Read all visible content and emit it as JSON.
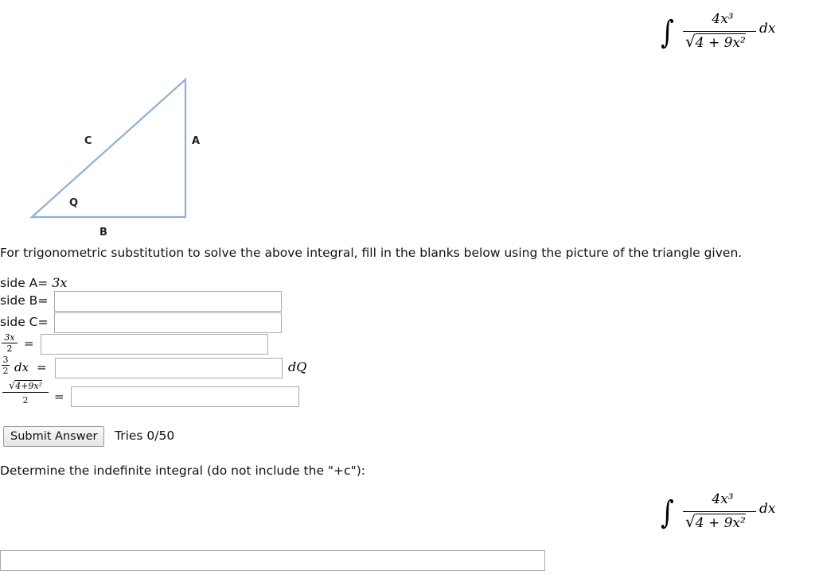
{
  "integral": {
    "sign": "∫",
    "numerator": "4x³",
    "denominator_radicand": "4 + 9x²",
    "differential": "dx"
  },
  "triangle": {
    "label_a": "A",
    "label_b": "B",
    "label_c": "C",
    "label_angle": "Q"
  },
  "instructions": "For trigonometric substitution to solve the above integral, fill in the blanks below using the picture of the triangle given.",
  "form": {
    "side_a_label": "side A=",
    "side_a_value": "3x",
    "side_b_label": "side B=",
    "side_b_value": "",
    "side_c_label": "side C=",
    "side_c_value": "",
    "ratio_numerator": "3x",
    "ratio_denominator": "2",
    "ratio_eq": "=",
    "ratio_value": "",
    "dx_coef_numerator": "3",
    "dx_coef_denominator": "2",
    "dx_label": "dx",
    "dx_eq": "=",
    "dx_value": "",
    "dq_suffix": "dQ",
    "sqrt_numerator": "4+9x²",
    "sqrt_denominator": "2",
    "sqrt_eq": "=",
    "sqrt_value": ""
  },
  "submit": {
    "label": "Submit Answer",
    "tries": "Tries 0/50"
  },
  "determine": {
    "text": "Determine the indefinite integral (do not include the \"+c\"):",
    "answer_value": ""
  }
}
